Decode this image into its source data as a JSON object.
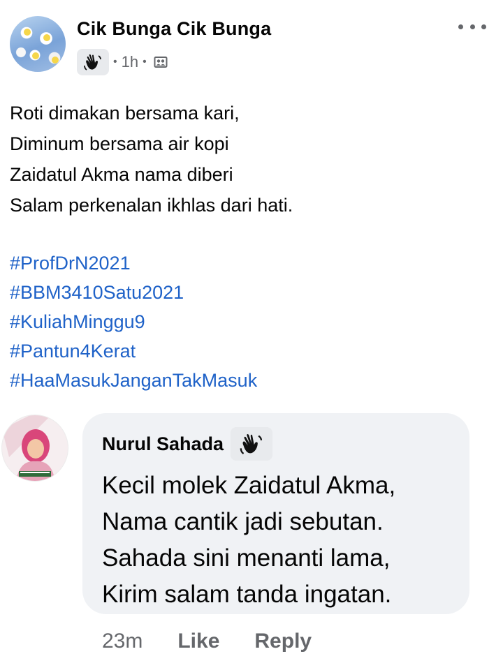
{
  "post": {
    "author": "Cik Bunga Cik Bunga",
    "time": "1h",
    "badge_icon": "waving-hand-icon",
    "audience_icon": "friends-icon",
    "body_lines": [
      "Roti dimakan bersama kari,",
      "Diminum bersama air kopi",
      "Zaidatul Akma nama diberi",
      "Salam perkenalan ikhlas dari hati."
    ],
    "hashtags": [
      "#ProfDrN2021",
      "#BBM3410Satu2021",
      "#KuliahMinggu9",
      "#Pantun4Kerat",
      "#HaaMasukJanganTakMasuk"
    ]
  },
  "comment": {
    "author": "Nurul Sahada",
    "badge_icon": "waving-hand-icon",
    "lines": [
      "Kecil molek Zaidatul Akma,",
      "Nama cantik jadi sebutan.",
      "Sahada sini menanti lama,",
      "Kirim salam tanda ingatan."
    ],
    "time": "23m",
    "like_label": "Like",
    "reply_label": "Reply"
  },
  "colors": {
    "hashtag": "#1f62c8",
    "secondary_text": "#65676b",
    "bubble": "#f0f2f5"
  }
}
